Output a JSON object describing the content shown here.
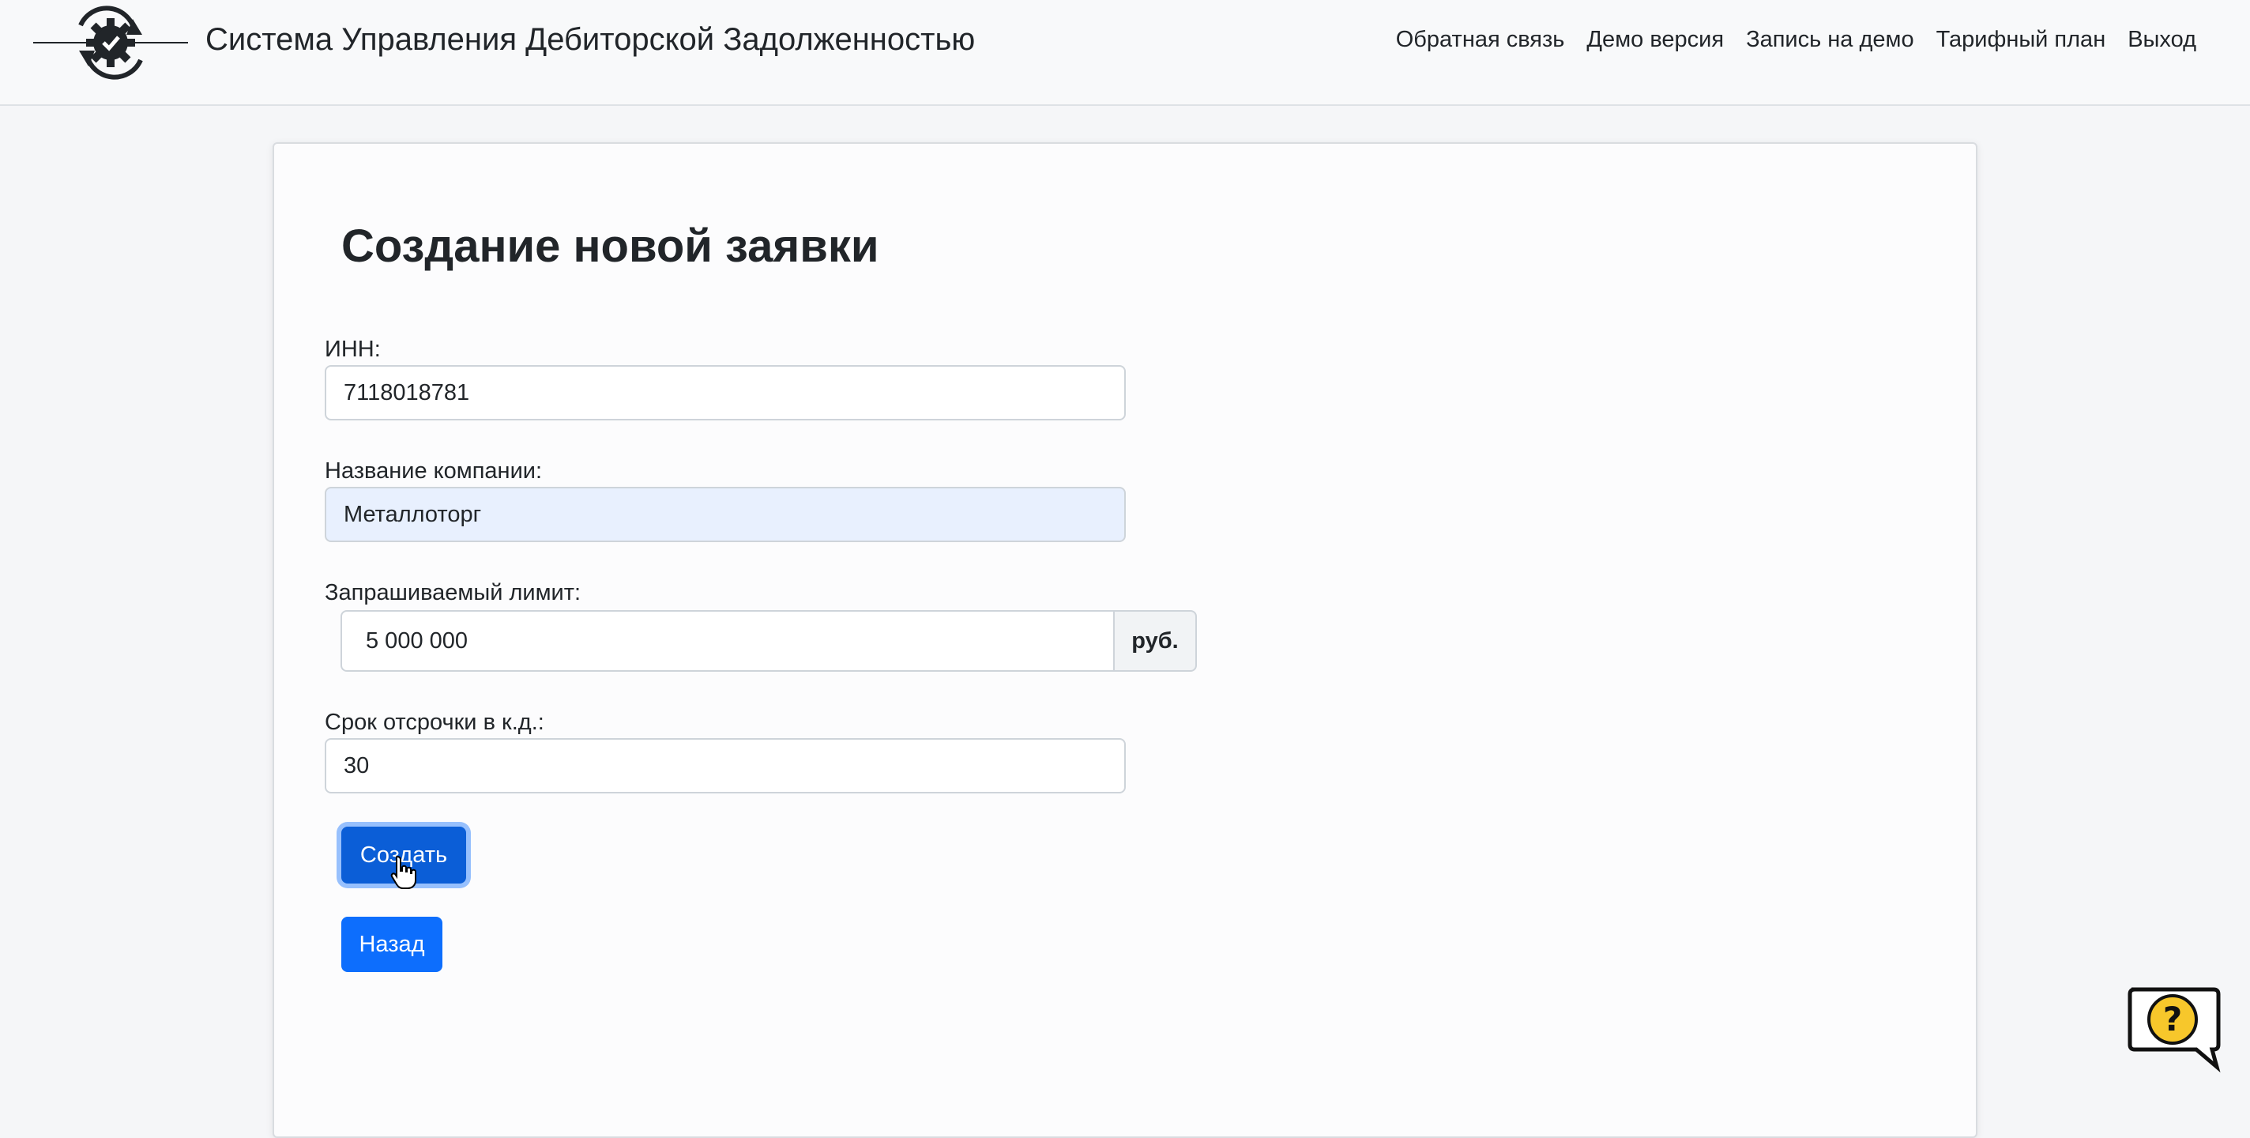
{
  "header": {
    "brand_title": "Система Управления Дебиторской Задолженностью",
    "nav_links": [
      {
        "label": "Обратная связь"
      },
      {
        "label": "Демо версия"
      },
      {
        "label": "Запись на демо"
      },
      {
        "label": "Тарифный план"
      },
      {
        "label": "Выход"
      }
    ]
  },
  "form": {
    "title": "Создание новой заявки",
    "inn": {
      "label": "ИНН:",
      "value": "7118018781"
    },
    "company_name": {
      "label": "Название компании:",
      "value": "Металлоторг"
    },
    "limit": {
      "label": "Запрашиваемый лимит:",
      "value": "5 000 000",
      "currency": "руб."
    },
    "deferral": {
      "label": "Срок отсрочки в к.д.:",
      "value": "30"
    },
    "create_button": "Создать",
    "back_button": "Назад"
  },
  "colors": {
    "primary": "#0d6efd",
    "primary_active": "#0b5ed7",
    "autofill_bg": "#e8f0fe",
    "help_yellow": "#f7c72b"
  },
  "icons": {
    "logo": "gear-cycle-logo-icon",
    "cursor": "hand-pointer-icon",
    "help": "question-speech-bubble-icon"
  }
}
